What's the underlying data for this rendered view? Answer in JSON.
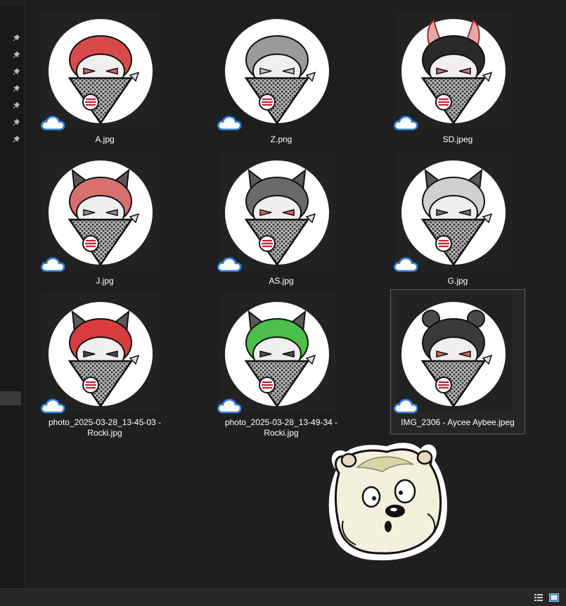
{
  "files": [
    {
      "name": "A.jpg",
      "name_line2": "",
      "hair": "#d84a4a",
      "accent": "#e06060",
      "ears": "none",
      "bg": "#222"
    },
    {
      "name": "Z.png",
      "name_line2": "",
      "hair": "#9a9a9a",
      "accent": "#c8c8c8",
      "ears": "none",
      "bg": "#1e1e1e"
    },
    {
      "name": "SD.jpeg",
      "name_line2": "",
      "hair": "#2a2a2a",
      "accent": "#d87070",
      "ears": "horns",
      "bg": "#222"
    },
    {
      "name": "J.jpg",
      "name_line2": "",
      "hair": "#d87070",
      "accent": "#8a8a8a",
      "ears": "cat",
      "bg": "#222"
    },
    {
      "name": "AS.jpg",
      "name_line2": "",
      "hair": "#6a6a6a",
      "accent": "#d86060",
      "ears": "cat",
      "bg": "#222"
    },
    {
      "name": "G.jpg",
      "name_line2": "",
      "hair": "#d0d0d0",
      "accent": "#707070",
      "ears": "cat",
      "bg": "#222"
    },
    {
      "name": "photo_2025-03-28_13-45-03 -",
      "name_line2": "Rocki.jpg",
      "hair": "#d83c3c",
      "accent": "#4a4a4a",
      "ears": "cat",
      "bg": "#222"
    },
    {
      "name": "photo_2025-03-28_13-49-34 -",
      "name_line2": "Rocki.jpg",
      "hair": "#4cbf4c",
      "accent": "#4a4a4a",
      "ears": "cat",
      "bg": "#222"
    },
    {
      "name": "IMG_2306 - Aycee Aybee.jpeg",
      "name_line2": "",
      "hair": "#3a3a3a",
      "accent": "#d86060",
      "ears": "round",
      "bg": "#222",
      "selected": true
    }
  ],
  "icons": {
    "pin": "pin-icon",
    "cloud": "cloud-icon",
    "details_view": "details-view-icon",
    "thumbnail_view": "thumbnail-view-icon"
  },
  "colors": {
    "background": "#1f1f1f",
    "cloud_outline": "#2f7fe0",
    "selection_border": "#5f5f5f"
  }
}
